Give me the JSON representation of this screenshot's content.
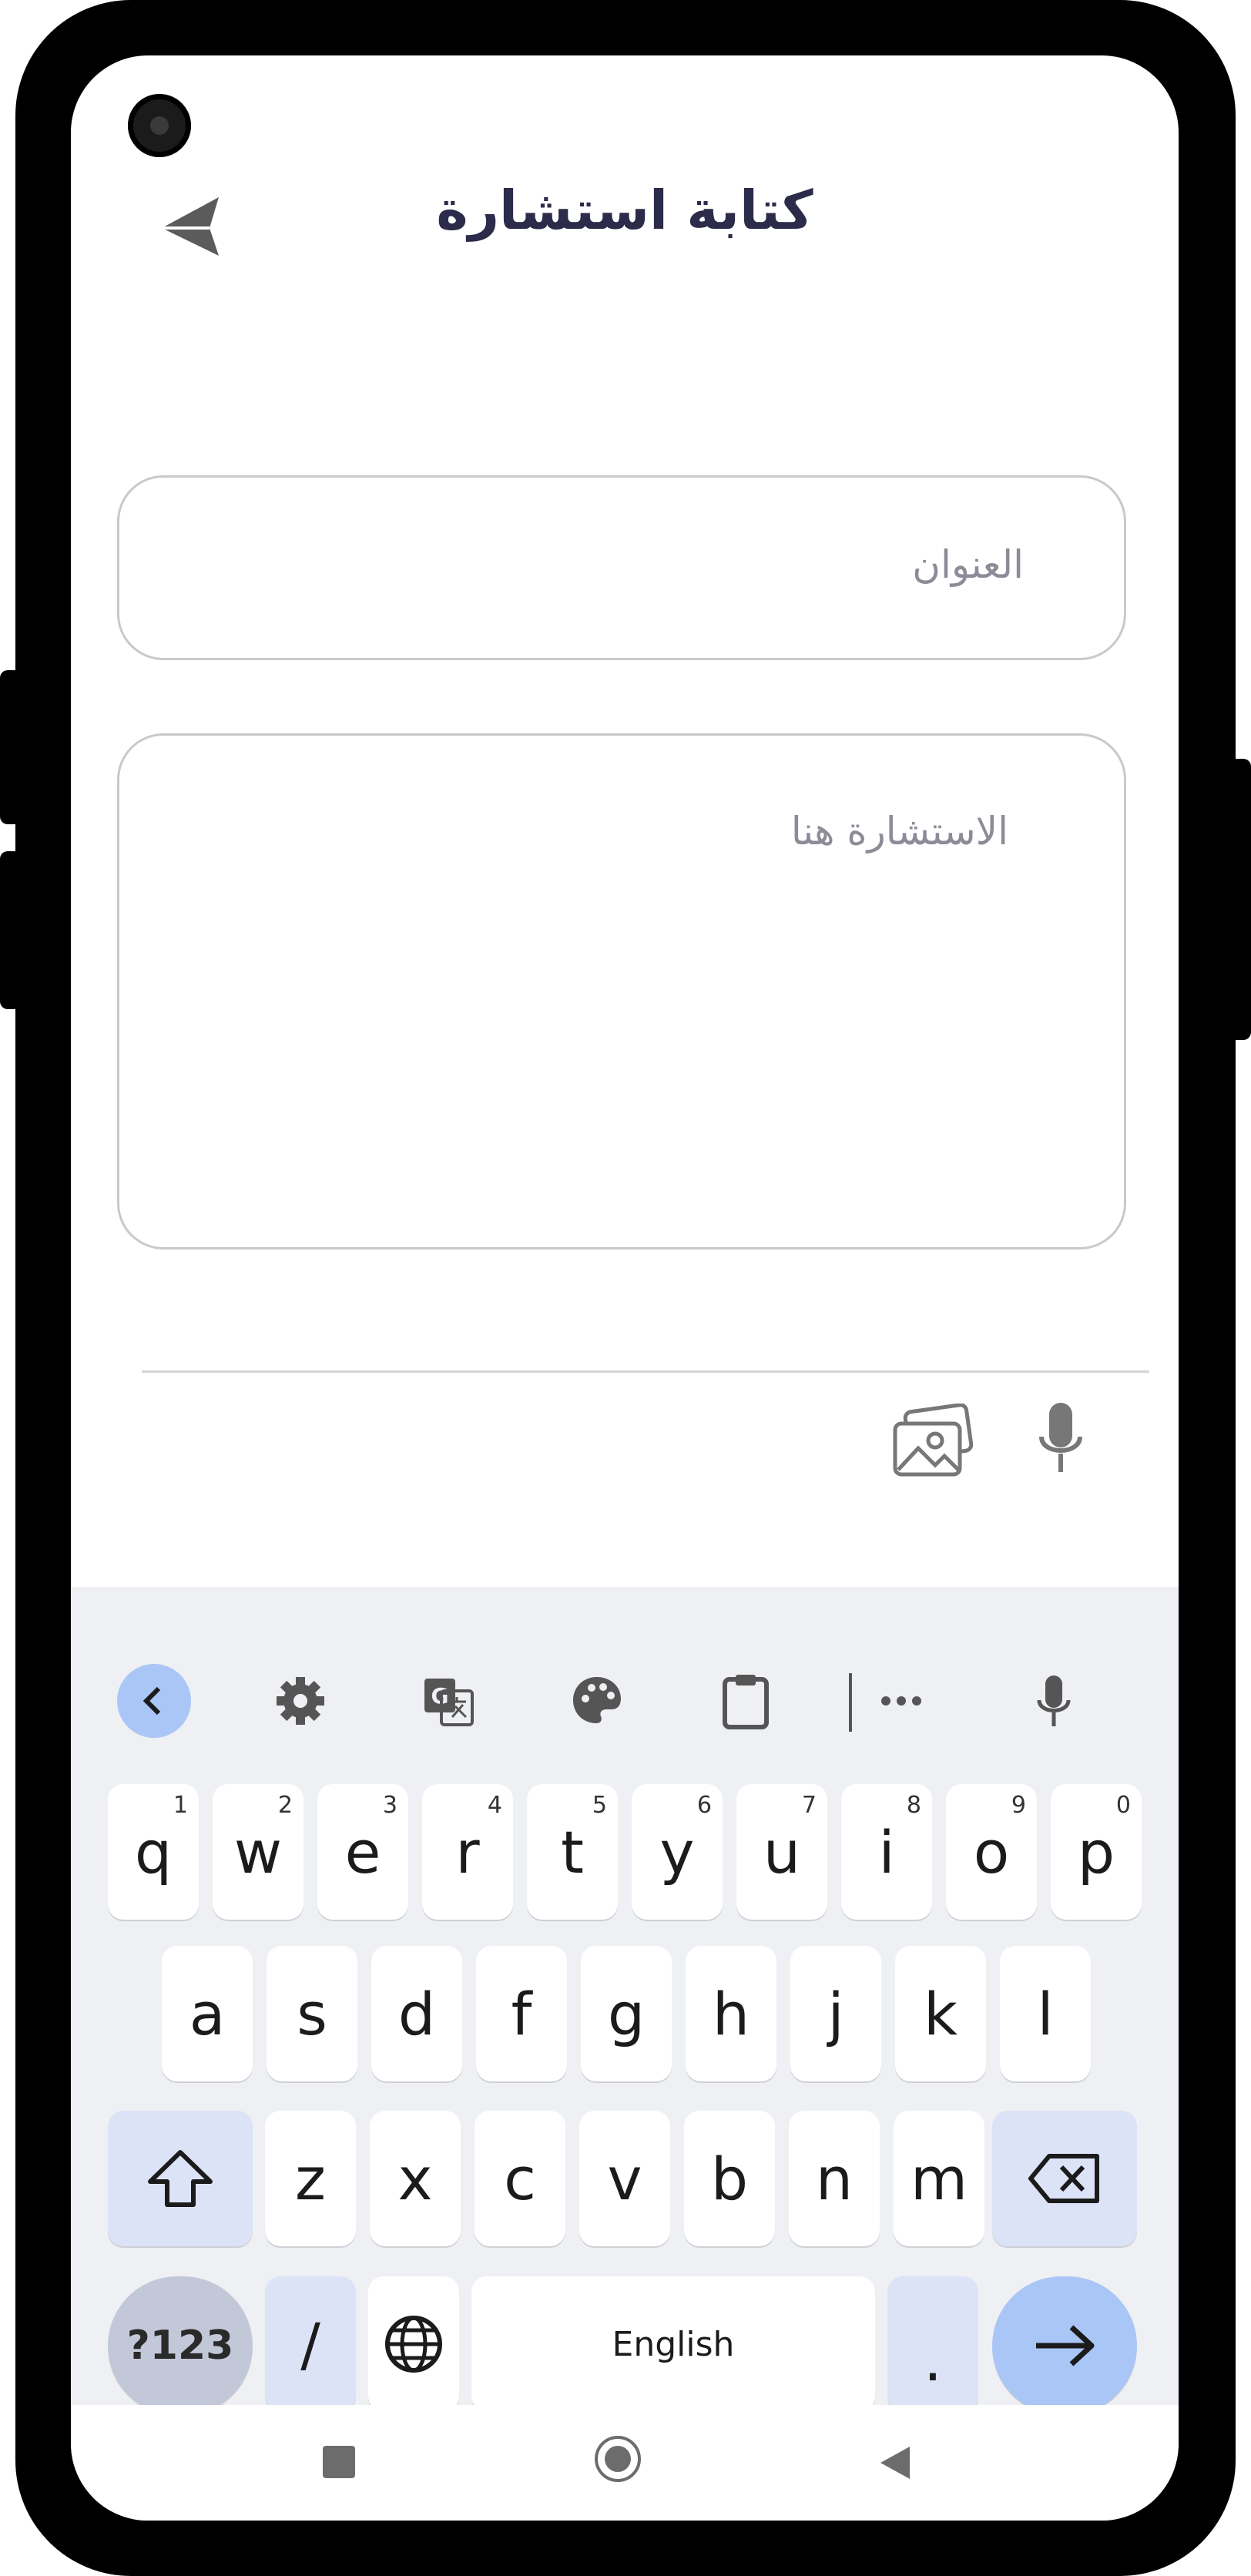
{
  "header": {
    "title": "كتابة استشارة",
    "back_icon": "send-arrow-icon"
  },
  "form": {
    "title_placeholder": "العنوان",
    "body_placeholder": "الاستشارة هنا"
  },
  "composer": {
    "gallery_icon": "image-gallery-icon",
    "mic_icon": "microphone-icon"
  },
  "keyboard": {
    "toolbar": [
      "chevron-left-icon",
      "gear-icon",
      "translate-icon",
      "palette-icon",
      "clipboard-icon",
      "more-icon",
      "microphone-icon"
    ],
    "row1": [
      {
        "k": "q",
        "n": "1"
      },
      {
        "k": "w",
        "n": "2"
      },
      {
        "k": "e",
        "n": "3"
      },
      {
        "k": "r",
        "n": "4"
      },
      {
        "k": "t",
        "n": "5"
      },
      {
        "k": "y",
        "n": "6"
      },
      {
        "k": "u",
        "n": "7"
      },
      {
        "k": "i",
        "n": "8"
      },
      {
        "k": "o",
        "n": "9"
      },
      {
        "k": "p",
        "n": "0"
      }
    ],
    "row2": [
      "a",
      "s",
      "d",
      "f",
      "g",
      "h",
      "j",
      "k",
      "l"
    ],
    "row3": [
      "z",
      "x",
      "c",
      "v",
      "b",
      "n",
      "m"
    ],
    "symbols_label": "?123",
    "slash_label": "/",
    "space_label": "English",
    "period_label": ".",
    "accent_color": "#a9c6f6"
  }
}
